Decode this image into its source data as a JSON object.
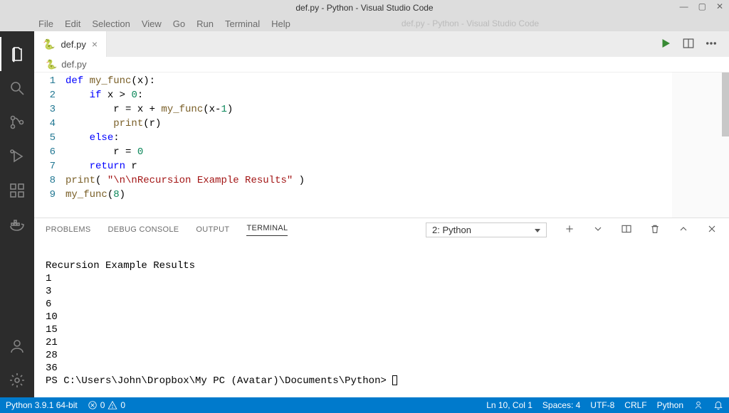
{
  "window": {
    "title": "def.py - Python - Visual Studio Code"
  },
  "menu": {
    "items": [
      "File",
      "Edit",
      "Selection",
      "View",
      "Go",
      "Run",
      "Terminal",
      "Help"
    ],
    "ghost_title": "def.py - Python - Visual Studio Code"
  },
  "tabs": {
    "active": "def.py"
  },
  "breadcrumb": {
    "file": "def.py"
  },
  "editor": {
    "lines": [
      {
        "n": 1,
        "tokens": [
          [
            "kw",
            "def "
          ],
          [
            "fn",
            "my_func"
          ],
          [
            "op",
            "(x):"
          ]
        ]
      },
      {
        "n": 2,
        "tokens": [
          [
            "op",
            "    "
          ],
          [
            "kw",
            "if"
          ],
          [
            "op",
            " x > "
          ],
          [
            "num",
            "0"
          ],
          [
            "op",
            ":"
          ]
        ]
      },
      {
        "n": 3,
        "tokens": [
          [
            "op",
            "        r = x + "
          ],
          [
            "fn",
            "my_func"
          ],
          [
            "op",
            "(x-"
          ],
          [
            "num",
            "1"
          ],
          [
            "op",
            ")"
          ]
        ]
      },
      {
        "n": 4,
        "tokens": [
          [
            "op",
            "        "
          ],
          [
            "fn",
            "print"
          ],
          [
            "op",
            "(r)"
          ]
        ]
      },
      {
        "n": 5,
        "tokens": [
          [
            "op",
            "    "
          ],
          [
            "kw",
            "else"
          ],
          [
            "op",
            ":"
          ]
        ]
      },
      {
        "n": 6,
        "tokens": [
          [
            "op",
            "        r = "
          ],
          [
            "num",
            "0"
          ]
        ]
      },
      {
        "n": 7,
        "tokens": [
          [
            "op",
            "    "
          ],
          [
            "kw",
            "return"
          ],
          [
            "op",
            " r"
          ]
        ]
      },
      {
        "n": 8,
        "tokens": [
          [
            "fn",
            "print"
          ],
          [
            "op",
            "( "
          ],
          [
            "str",
            "\"\\n\\nRecursion Example Results\""
          ],
          [
            "op",
            " )"
          ]
        ]
      },
      {
        "n": 9,
        "tokens": [
          [
            "fn",
            "my_func"
          ],
          [
            "op",
            "("
          ],
          [
            "num",
            "8"
          ],
          [
            "op",
            ")"
          ]
        ]
      }
    ]
  },
  "panel": {
    "tabs": [
      "PROBLEMS",
      "DEBUG CONSOLE",
      "OUTPUT",
      "TERMINAL"
    ],
    "active_tab": "TERMINAL",
    "terminal_selector": "2: Python",
    "terminal_lines": [
      "",
      "Recursion Example Results",
      "1",
      "3",
      "6",
      "10",
      "15",
      "21",
      "28",
      "36"
    ],
    "prompt": "PS C:\\Users\\John\\Dropbox\\My PC (Avatar)\\Documents\\Python> "
  },
  "status": {
    "interpreter": "Python 3.9.1 64-bit",
    "errors": "0",
    "warnings": "0",
    "cursor": "Ln 10, Col 1",
    "spaces": "Spaces: 4",
    "encoding": "UTF-8",
    "eol": "CRLF",
    "language": "Python"
  }
}
